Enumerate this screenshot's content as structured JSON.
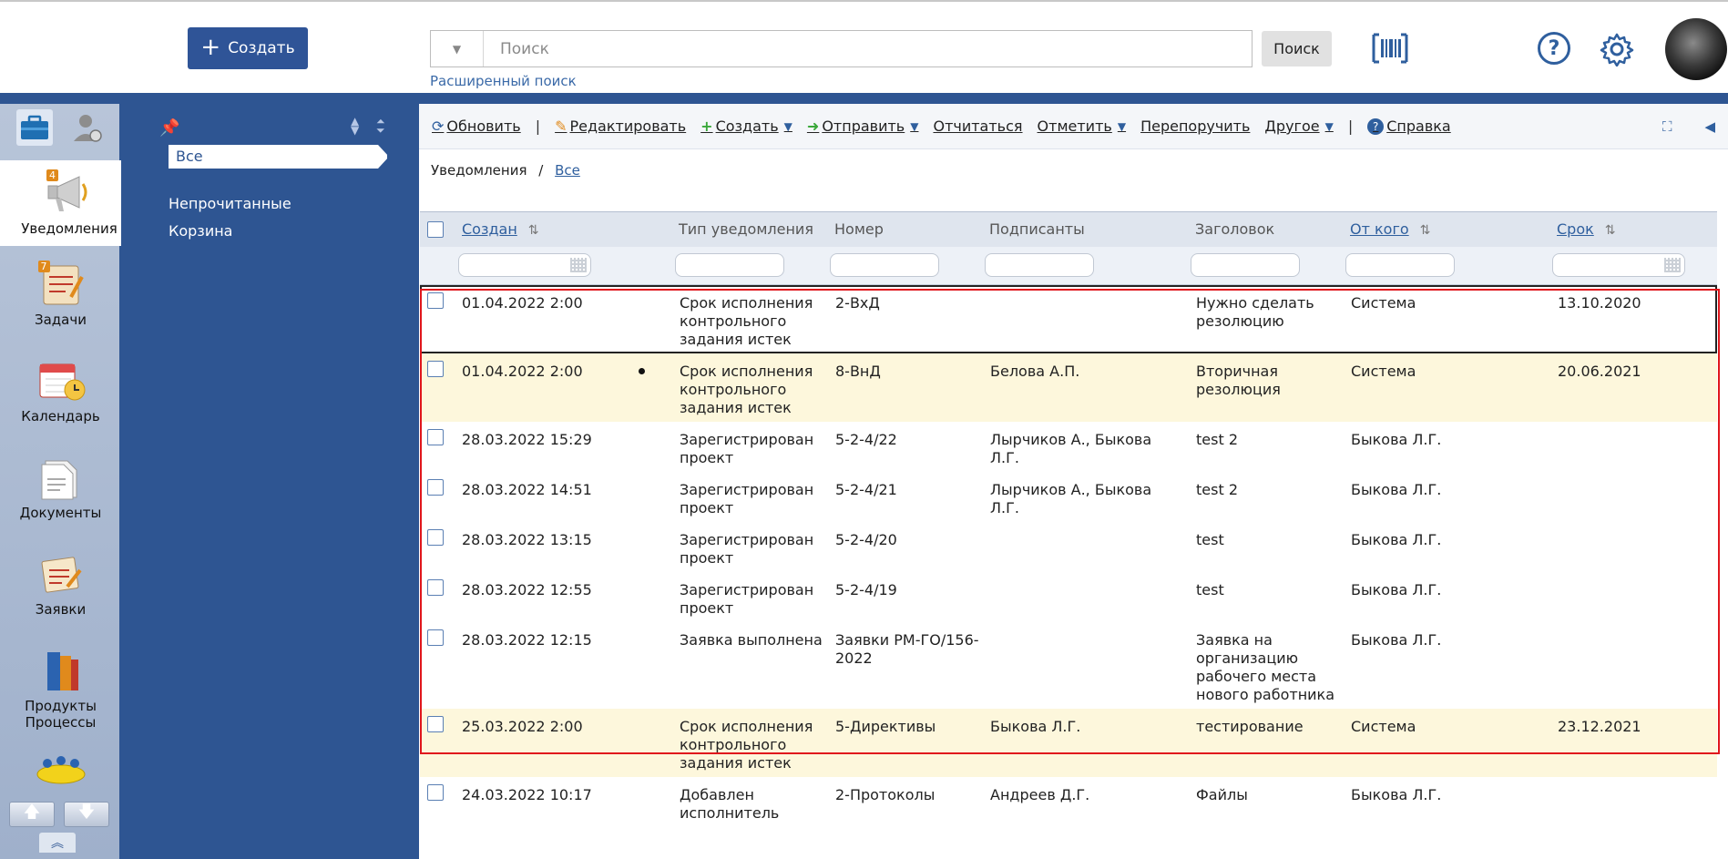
{
  "header": {
    "create_label": "Создать",
    "search_placeholder": "Поиск",
    "search_button": "Поиск",
    "advanced_search": "Расширенный поиск"
  },
  "rail": {
    "items": [
      {
        "label": "Уведомления",
        "badge": "4"
      },
      {
        "label": "Задачи",
        "badge": "7"
      },
      {
        "label": "Календарь"
      },
      {
        "label": "Документы"
      },
      {
        "label": "Заявки"
      },
      {
        "label": "Продукты Процессы"
      }
    ]
  },
  "folders": {
    "items": [
      "Все",
      "Непрочитанные",
      "Корзина"
    ]
  },
  "toolbar": {
    "refresh": "Обновить",
    "edit": "Редактировать",
    "create": "Создать",
    "send": "Отправить",
    "report": "Отчитаться",
    "mark": "Отметить",
    "reassign": "Перепоручить",
    "other": "Другое",
    "help": "Справка"
  },
  "breadcrumb": {
    "root": "Уведомления",
    "separator": "/",
    "current": "Все"
  },
  "table": {
    "columns": {
      "created": "Создан",
      "type": "Тип уведомления",
      "number": "Номер",
      "signers": "Подписанты",
      "title": "Заголовок",
      "from": "От кого",
      "deadline": "Срок"
    },
    "rows": [
      {
        "created": "01.04.2022 2:00",
        "type": "Срок исполнения контрольного задания истек",
        "number": "2-ВхД",
        "signers": "",
        "title": "Нужно сделать резолюцию",
        "from": "Система",
        "deadline": "13.10.2020",
        "dot": false
      },
      {
        "created": "01.04.2022 2:00",
        "type": "Срок исполнения контрольного задания истек",
        "number": "8-ВнД",
        "signers": "Белова А.П.",
        "title": "Вторичная резолюция",
        "from": "Система",
        "deadline": "20.06.2021",
        "dot": true
      },
      {
        "created": "28.03.2022 15:29",
        "type": "Зарегистрирован проект",
        "number": "5-2-4/22",
        "signers": "Лырчиков А., Быкова Л.Г.",
        "title": "test 2",
        "from": "Быкова Л.Г.",
        "deadline": "",
        "dot": false
      },
      {
        "created": "28.03.2022 14:51",
        "type": "Зарегистрирован проект",
        "number": "5-2-4/21",
        "signers": "Лырчиков А., Быкова Л.Г.",
        "title": "test 2",
        "from": "Быкова Л.Г.",
        "deadline": "",
        "dot": false
      },
      {
        "created": "28.03.2022 13:15",
        "type": "Зарегистрирован проект",
        "number": "5-2-4/20",
        "signers": "",
        "title": "test",
        "from": "Быкова Л.Г.",
        "deadline": "",
        "dot": false
      },
      {
        "created": "28.03.2022 12:55",
        "type": "Зарегистрирован проект",
        "number": "5-2-4/19",
        "signers": "",
        "title": "test",
        "from": "Быкова Л.Г.",
        "deadline": "",
        "dot": false
      },
      {
        "created": "28.03.2022 12:15",
        "type": "Заявка выполнена",
        "number": "Заявки РМ-ГО/156-2022",
        "signers": "",
        "title": "Заявка на организацию рабочего места нового работника",
        "from": "Быкова Л.Г.",
        "deadline": "",
        "dot": false
      },
      {
        "created": "25.03.2022 2:00",
        "type": "Срок исполнения контрольного задания истек",
        "number": "5-Директивы",
        "signers": "Быкова Л.Г.",
        "title": "тестирование",
        "from": "Система",
        "deadline": "23.12.2021",
        "dot": false
      },
      {
        "created": "24.03.2022 10:17",
        "type": "Добавлен исполнитель",
        "number": "2-Протоколы",
        "signers": "Андреев Д.Г.",
        "title": "Файлы",
        "from": "Быкова Л.Г.",
        "deadline": "",
        "dot": false
      }
    ]
  }
}
